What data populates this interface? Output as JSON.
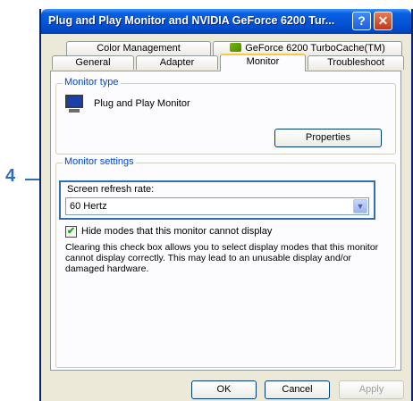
{
  "annotation": {
    "step_number": "4"
  },
  "window": {
    "title": "Plug and Play Monitor and NVIDIA GeForce 6200 Tur...",
    "help_button": "?",
    "close_button": "✕"
  },
  "tabs": {
    "row1": [
      {
        "label": "Color Management",
        "icon": null
      },
      {
        "label": "GeForce 6200 TurboCache(TM)",
        "icon": "nvidia-icon"
      }
    ],
    "row2": [
      {
        "label": "General"
      },
      {
        "label": "Adapter"
      },
      {
        "label": "Monitor",
        "active": true
      },
      {
        "label": "Troubleshoot"
      }
    ]
  },
  "monitor_type": {
    "legend": "Monitor type",
    "icon": "monitor-icon",
    "name": "Plug and Play Monitor",
    "properties_button": "Properties"
  },
  "monitor_settings": {
    "legend": "Monitor settings",
    "refresh_label": "Screen refresh rate:",
    "refresh_value": "60 Hertz",
    "hide_modes_checked": true,
    "hide_modes_label": "Hide modes that this monitor cannot display",
    "note": "Clearing this check box allows you to select display modes that this monitor cannot display correctly. This may lead to an unusable display and/or damaged hardware."
  },
  "buttons": {
    "ok": "OK",
    "cancel": "Cancel",
    "apply": "Apply"
  },
  "colors": {
    "accent": "#2f6fb8",
    "titlebar": "#0452d6",
    "group_legend": "#0046d5"
  }
}
